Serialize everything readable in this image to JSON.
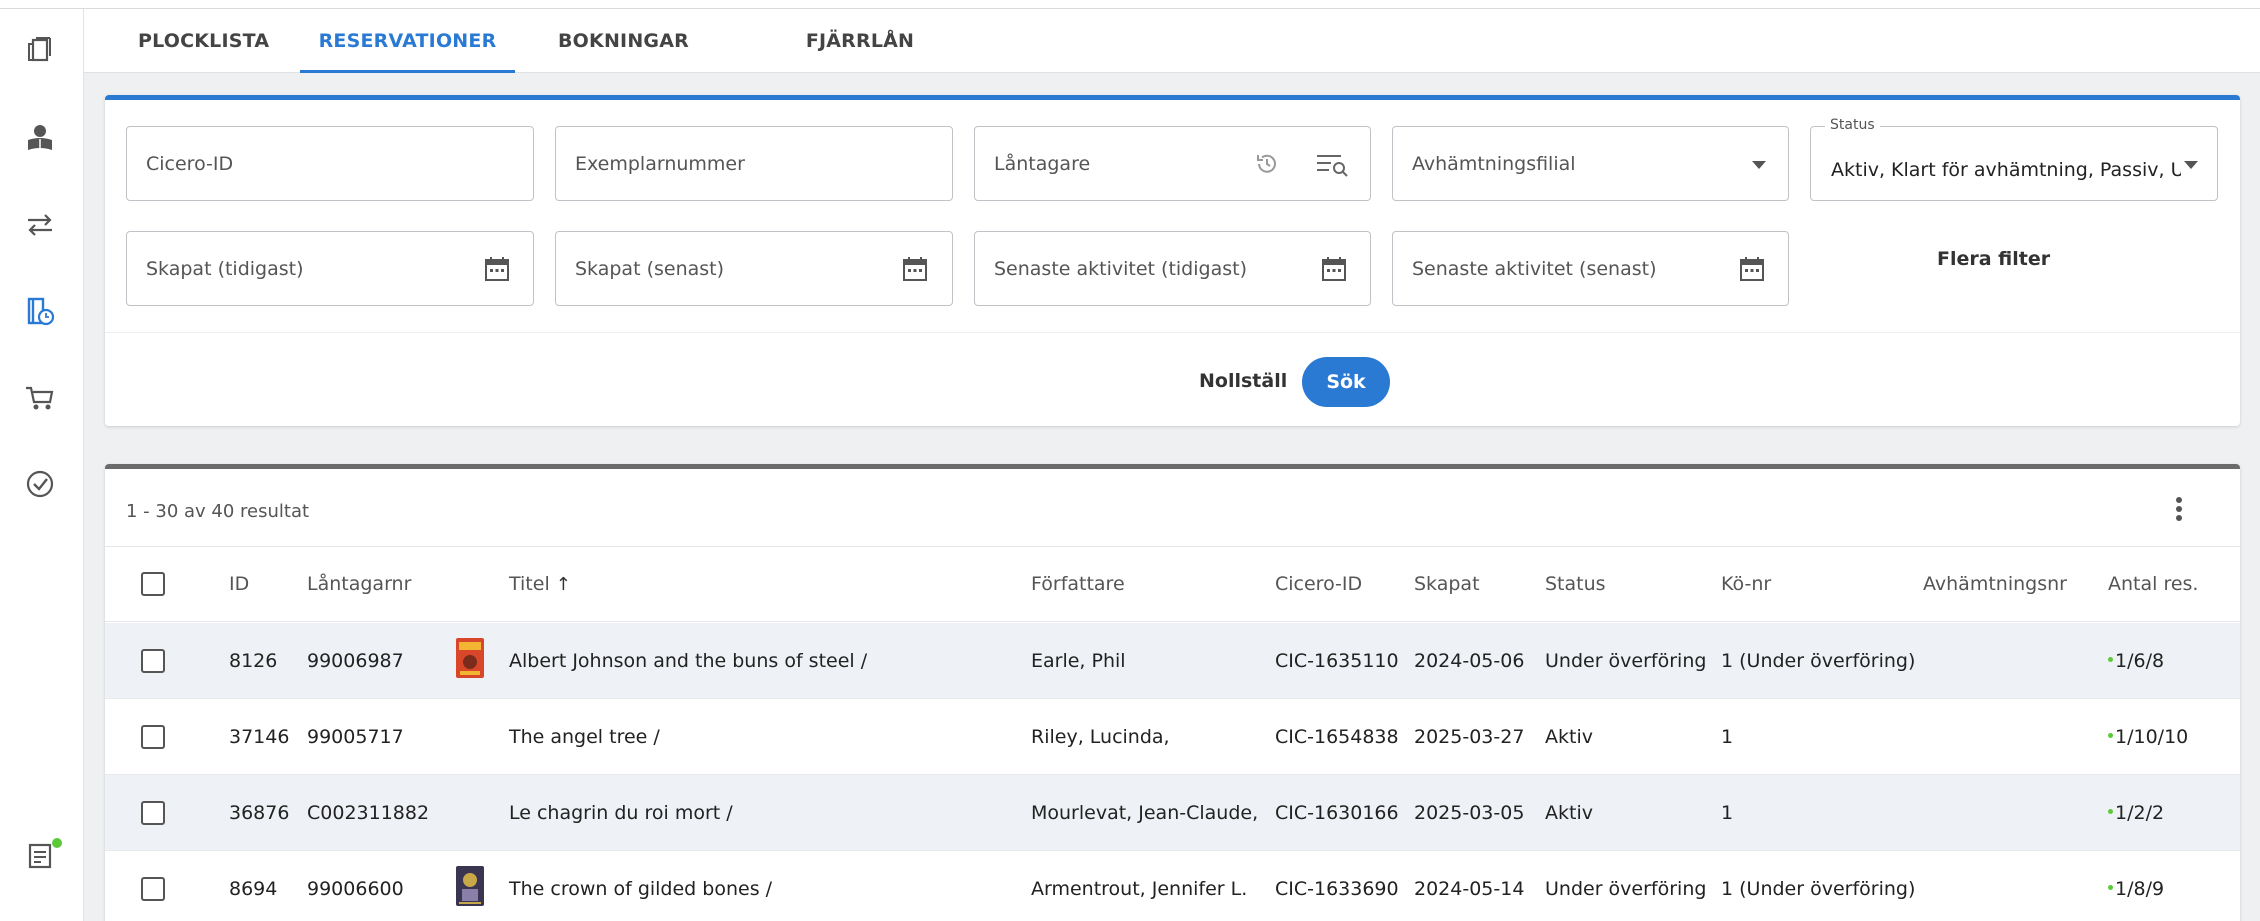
{
  "tabs": [
    {
      "label": "PLOCKLISTA",
      "active": false
    },
    {
      "label": "RESERVATIONER",
      "active": true
    },
    {
      "label": "BOKNINGAR",
      "active": false
    },
    {
      "label": "FJÄRRLÅN",
      "active": false
    }
  ],
  "sidebar": {
    "icons": [
      "books-icon",
      "reader-icon",
      "transfer-arrows-icon",
      "reservation-clock-icon",
      "cart-icon",
      "check-circle-icon",
      "report-icon"
    ],
    "active_icon": "reservation-clock-icon"
  },
  "filters": {
    "cicero_id": "Cicero-ID",
    "exemplar": "Exemplarnummer",
    "lantagare": "Låntagare",
    "filial": "Avhämtningsfilial",
    "status_legend": "Status",
    "status_value": "Aktiv, Klart för avhämtning, Passiv, Und...",
    "created_from": "Skapat (tidigast)",
    "created_to": "Skapat (senast)",
    "activity_from": "Senaste aktivitet (tidigast)",
    "activity_to": "Senaste aktivitet (senast)",
    "more_filters": "Flera filter",
    "reset": "Nollställ",
    "search": "Sök"
  },
  "results": {
    "count_text": "1 - 30 av 40 resultat",
    "columns": {
      "id": "ID",
      "borrower": "Låntagarnr",
      "title": "Titel",
      "title_sort": "↑",
      "author": "Författare",
      "cicero": "Cicero-ID",
      "created": "Skapat",
      "status": "Status",
      "queue": "Kö-nr",
      "pickup": "Avhämtningsnr",
      "count": "Antal res."
    },
    "rows": [
      {
        "id": "8126",
        "borrower": "99006987",
        "title": "Albert Johnson and the buns of steel /",
        "author": "Earle, Phil",
        "cicero": "CIC-1635110",
        "created": "2024-05-06",
        "status": "Under överföring",
        "queue": "1 (Under överföring)",
        "pickup": "",
        "count": "1/6/8"
      },
      {
        "id": "37146",
        "borrower": "99005717",
        "title": "The angel tree /",
        "author": "Riley, Lucinda,",
        "cicero": "CIC-1654838",
        "created": "2025-03-27",
        "status": "Aktiv",
        "queue": "1",
        "pickup": "",
        "count": "1/10/10"
      },
      {
        "id": "36876",
        "borrower": "C002311882",
        "title": "Le chagrin du roi mort /",
        "author": "Mourlevat, Jean-Claude,",
        "cicero": "CIC-1630166",
        "created": "2025-03-05",
        "status": "Aktiv",
        "queue": "1",
        "pickup": "",
        "count": "1/2/2"
      },
      {
        "id": "8694",
        "borrower": "99006600",
        "title": "The crown of gilded bones /",
        "author": "Armentrout, Jennifer L.",
        "cicero": "CIC-1633690",
        "created": "2024-05-14",
        "status": "Under överföring",
        "queue": "1 (Under överföring)",
        "pickup": "",
        "count": "1/8/9"
      }
    ]
  },
  "colors": {
    "accent": "#2a7ad4",
    "status_dot": "#5cc93b"
  }
}
